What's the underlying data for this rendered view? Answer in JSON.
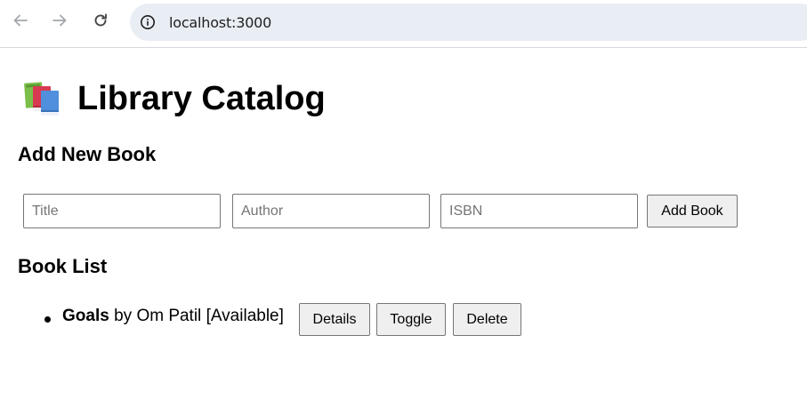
{
  "browser": {
    "url": "localhost:3000",
    "icons": {
      "back": "arrow-left-icon",
      "forward": "arrow-right-icon",
      "reload": "reload-icon",
      "site_info": "info-icon"
    }
  },
  "page": {
    "title": "Library Catalog",
    "title_icon": "books-icon"
  },
  "add_section": {
    "heading": "Add New Book",
    "fields": {
      "title": {
        "placeholder": "Title",
        "value": ""
      },
      "author": {
        "placeholder": "Author",
        "value": ""
      },
      "isbn": {
        "placeholder": "ISBN",
        "value": ""
      }
    },
    "submit_label": "Add Book"
  },
  "list_section": {
    "heading": "Book List",
    "books": [
      {
        "title": "Goals",
        "by": " by ",
        "author": "Om Patil",
        "status": "[Available]",
        "details_label": "Details",
        "toggle_label": "Toggle",
        "delete_label": "Delete"
      }
    ]
  },
  "colors": {
    "omnibox_bg": "#e9edf4",
    "button_bg": "#efefef",
    "input_border": "#767676"
  }
}
